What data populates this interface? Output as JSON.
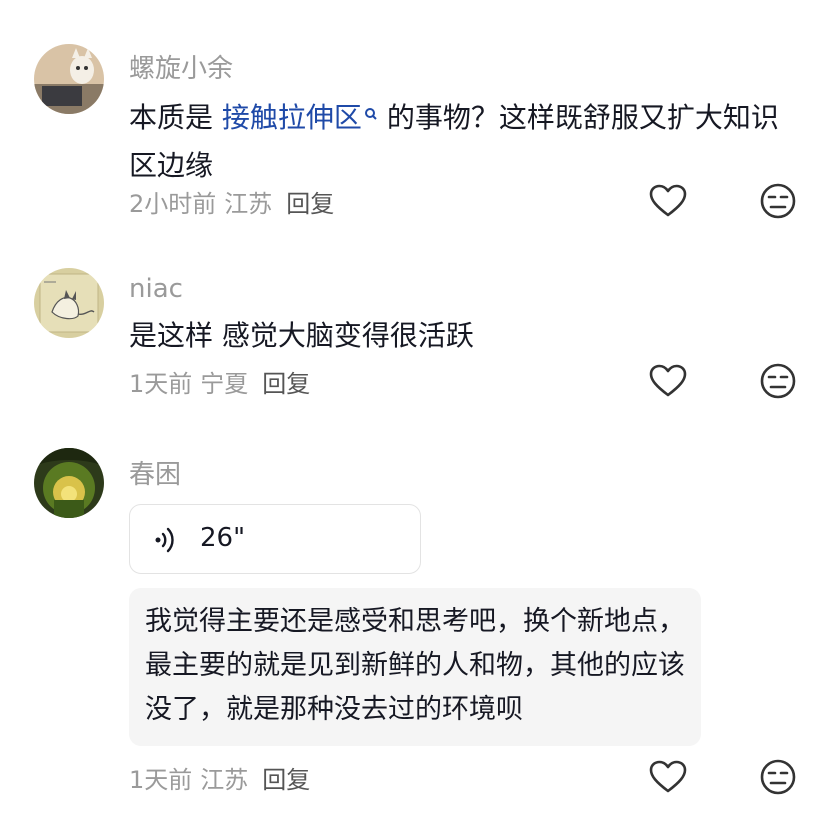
{
  "comments": [
    {
      "username": "螺旋小余",
      "text_before": "本质是 ",
      "link_text": "接触拉伸区",
      "text_after": " 的事物？这样既舒服又扩大知识区边缘",
      "time": "2小时前",
      "location": "江苏",
      "reply_label": "回复",
      "avatar_icon": "cat-laptop-photo-avatar",
      "link_icon": "search-icon"
    },
    {
      "username": "niac",
      "text": "是这样 感觉大脑变得很活跃",
      "time": "1天前",
      "location": "宁夏",
      "reply_label": "回复",
      "avatar_icon": "cat-sketch-avatar"
    },
    {
      "username": "春困",
      "voice_duration": "26\"",
      "voice_icon": "voice-wave-icon",
      "text": "我觉得主要还是感受和思考吧，换个新地点，最主要的就是见到新鲜的人和物，其他的应该没了，就是那种没去过的环境呗",
      "time": "1天前",
      "location": "江苏",
      "reply_label": "回复",
      "avatar_icon": "forest-light-avatar"
    }
  ],
  "icons": {
    "like": "heart-outline-icon",
    "dislike": "neutral-face-icon"
  },
  "colors": {
    "link": "#1f4aa8",
    "meta": "#9a9a9a",
    "text": "#161823",
    "quote_bg": "#f5f5f5"
  }
}
